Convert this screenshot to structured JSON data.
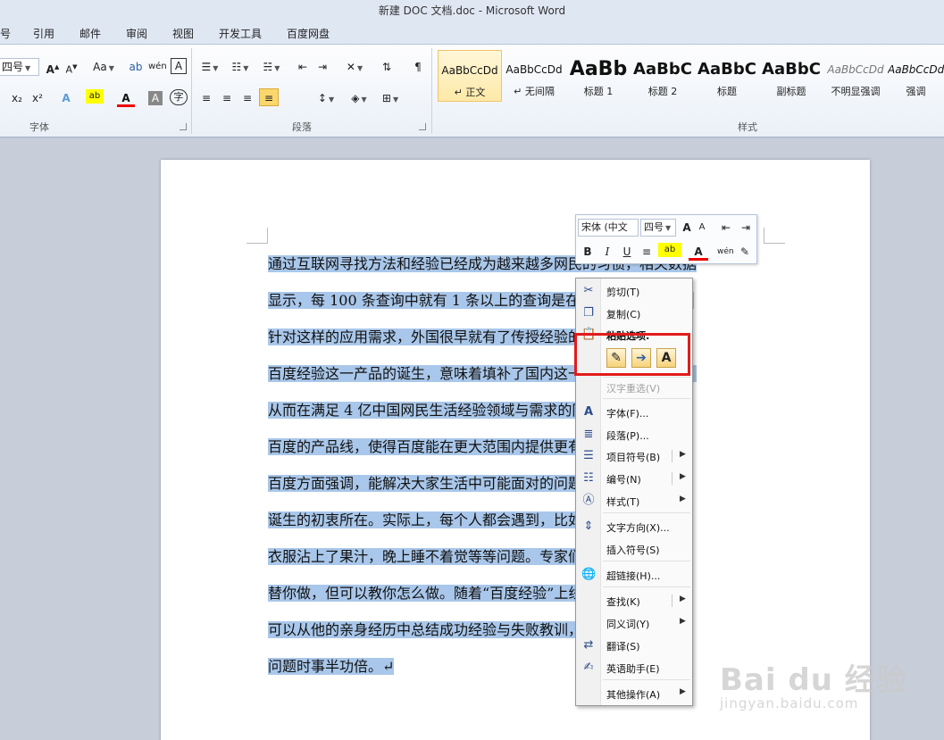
{
  "window": {
    "title": "新建 DOC 文档.doc - Microsoft Word"
  },
  "ribbon_tabs": [
    "号",
    "引用",
    "邮件",
    "审阅",
    "视图",
    "开发工具",
    "百度网盘"
  ],
  "font_group": {
    "label": "字体",
    "size_value": "四号",
    "grow_label": "A",
    "shrink_label": "A",
    "case_label": "Aa",
    "subscript_label": "x₂",
    "superscript_label": "x²",
    "font_color_label": "A",
    "char_shade_label": "A",
    "enclose_label": "字"
  },
  "paragraph_group": {
    "label": "段落"
  },
  "styles_group": {
    "label": "样式",
    "items": [
      {
        "sample": "AaBbCcDd",
        "name": "↵ 正文"
      },
      {
        "sample": "AaBbCcDd",
        "name": "↵ 无间隔"
      },
      {
        "sample": "AaBb",
        "name": "标题 1"
      },
      {
        "sample": "AaBbC",
        "name": "标题 2"
      },
      {
        "sample": "AaBbC",
        "name": "标题"
      },
      {
        "sample": "AaBbC",
        "name": "副标题"
      },
      {
        "sample": "AaBbCcDd",
        "name": "不明显强调"
      },
      {
        "sample": "AaBbCcDd",
        "name": "强调"
      }
    ]
  },
  "document": {
    "lines": [
      "通过互联网寻找方法和经验已经成为越来越多网民的习惯，相关数据",
      "显示，每 100 条查询中就有 1 条以上的查询是在寻找解决的方法。",
      "针对这样的应用需求，外国很早就有了传授经验的专业网站。此次",
      "百度经验这一产品的诞生，意味着填补了国内这一领域的空白地带，",
      "从而在满足 4 亿中国网民生活经验领域与需求的同时，进一步丰富",
      "百度的产品线，使得百度能在更大范围内提供更有价值的力量。↵",
      "百度方面强调，能解决大家生活中可能面对的问题，正是百度经验",
      "诞生的初衷所在。实际上，每个人都会遇到，比如手机屏不亮了，",
      "衣服沾上了果汁，晚上睡不着觉等等问题。专家们说，互联网不能",
      "替你做，但可以教你怎么做。随着“百度经验”上线，网友们更是",
      "可以从他的亲身经历中总结成功经验与失败教训，以便后面对同一",
      "问题时事半功倍。↵"
    ]
  },
  "mini_toolbar": {
    "font_value": "宋体 (中文",
    "size_value": "四号",
    "bold": "B",
    "italic": "I",
    "underline": "U",
    "font_color": "A",
    "grow": "A",
    "shrink": "A"
  },
  "context_menu": {
    "items": [
      {
        "label": "剪切(T)",
        "icon": "scissors-icon"
      },
      {
        "label": "复制(C)",
        "icon": "copy-icon"
      },
      {
        "label": "粘贴选项:",
        "icon": "paste-icon"
      },
      {
        "label": "汉字重选(V)",
        "icon": ""
      },
      {
        "label": "字体(F)...",
        "icon": "font-icon"
      },
      {
        "label": "段落(P)...",
        "icon": "paragraph-icon"
      },
      {
        "label": "项目符号(B)",
        "icon": "bullets-icon"
      },
      {
        "label": "编号(N)",
        "icon": "numbering-icon"
      },
      {
        "label": "样式(T)",
        "icon": "styles-icon"
      },
      {
        "label": "文字方向(X)...",
        "icon": "text-direction-icon"
      },
      {
        "label": "插入符号(S)",
        "icon": ""
      },
      {
        "label": "超链接(H)...",
        "icon": "hyperlink-icon"
      },
      {
        "label": "查找(K)",
        "icon": ""
      },
      {
        "label": "同义词(Y)",
        "icon": ""
      },
      {
        "label": "翻译(S)",
        "icon": "translate-icon"
      },
      {
        "label": "英语助手(E)",
        "icon": "english-assistant-icon"
      },
      {
        "label": "其他操作(A)",
        "icon": ""
      }
    ],
    "paste_options": [
      "keep-source",
      "merge-format",
      "A"
    ]
  },
  "watermark": {
    "main": "Bai du 经验",
    "sub": "jingyan.baidu.com"
  }
}
